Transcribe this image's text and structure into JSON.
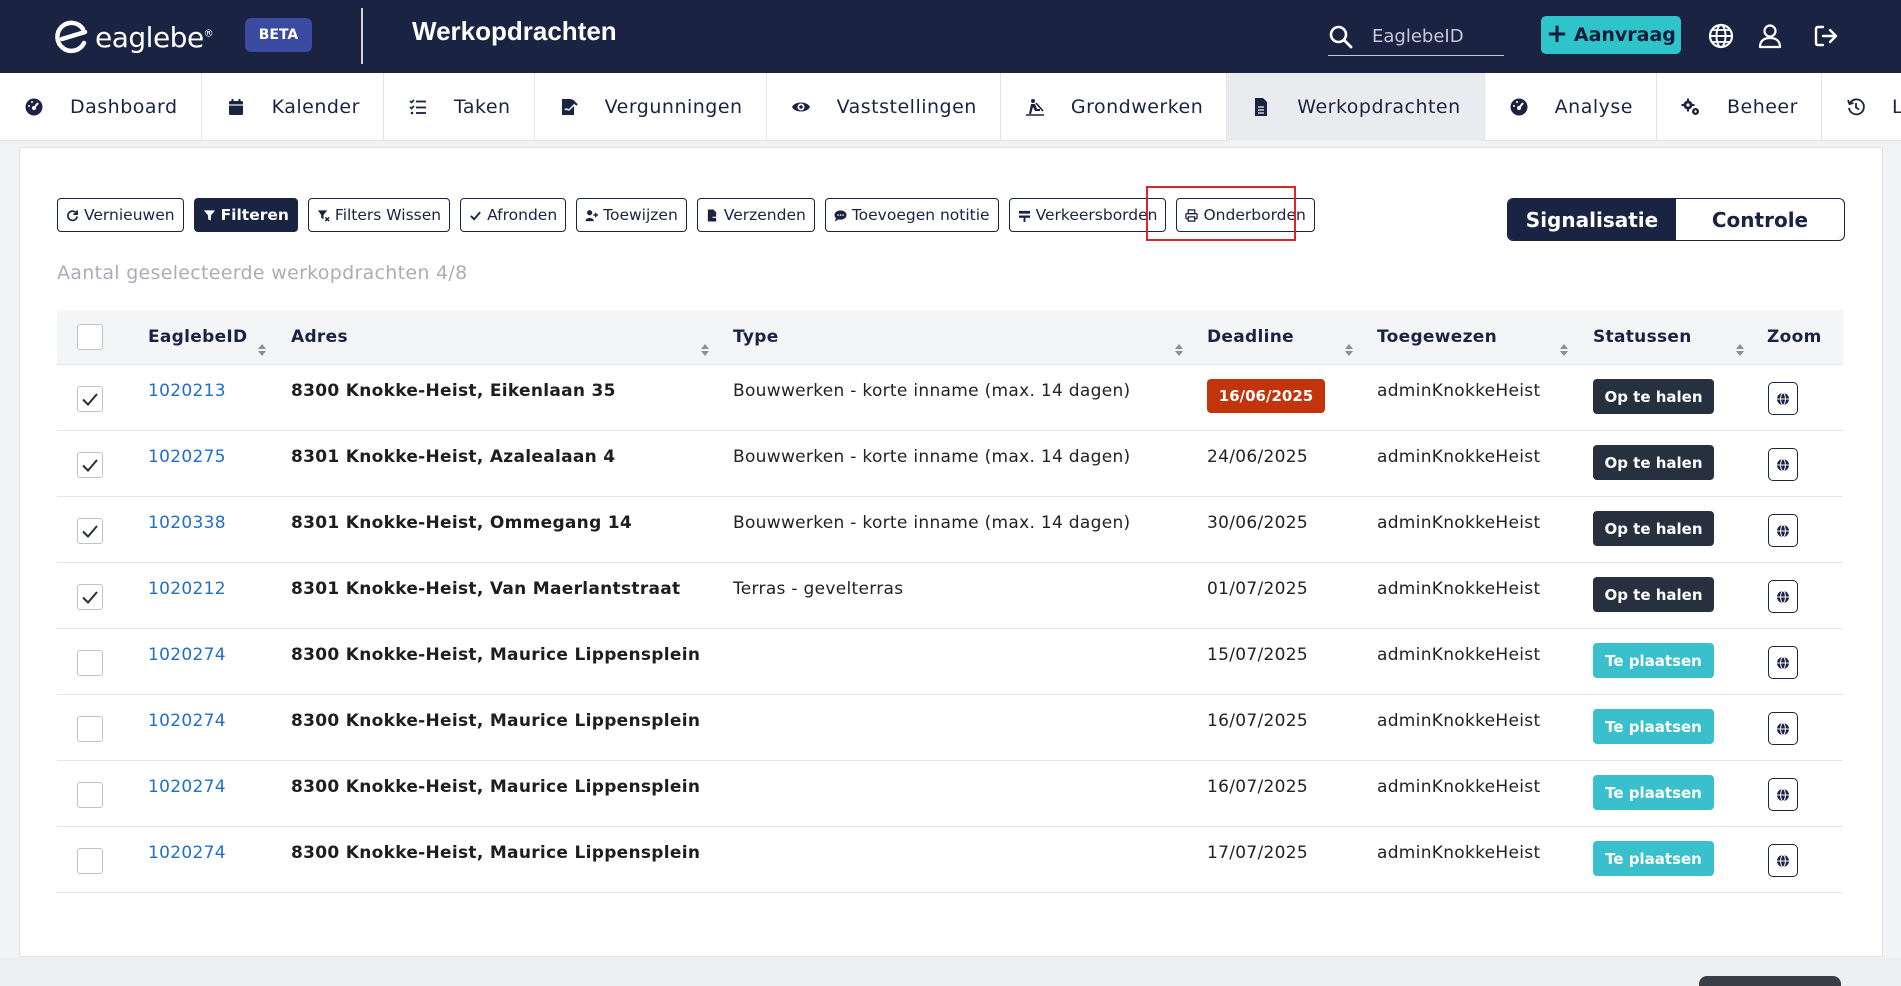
{
  "header": {
    "logo_text": "eaglebe",
    "logo_sup": "®",
    "beta_label": "BETA",
    "page_title": "Werkopdrachten",
    "search": {
      "placeholder": "EaglebeID",
      "value": ""
    },
    "aanvraag_label": "Aanvraag",
    "brand_color": "#1a2442",
    "accent_color": "#2ec4c9"
  },
  "nav": {
    "items": [
      {
        "label": "Dashboard",
        "icon": "gauge-icon"
      },
      {
        "label": "Kalender",
        "icon": "calendar-icon"
      },
      {
        "label": "Taken",
        "icon": "task-list-icon"
      },
      {
        "label": "Vergunningen",
        "icon": "signature-icon"
      },
      {
        "label": "Vaststellingen",
        "icon": "eye-icon"
      },
      {
        "label": "Grondwerken",
        "icon": "digging-icon"
      },
      {
        "label": "Werkopdrachten",
        "icon": "document-icon",
        "active": true
      },
      {
        "label": "Analyse",
        "icon": "gauge-icon"
      },
      {
        "label": "Beheer",
        "icon": "gears-icon"
      },
      {
        "label": "Logs",
        "icon": "history-icon"
      }
    ]
  },
  "toolbar": {
    "buttons": [
      {
        "label": "Vernieuwen",
        "icon": "refresh-icon"
      },
      {
        "label": "Filteren",
        "icon": "filter-icon",
        "active": true
      },
      {
        "label": "Filters Wissen",
        "icon": "filter-clear-icon"
      },
      {
        "label": "Afronden",
        "icon": "check-icon"
      },
      {
        "label": "Toewijzen",
        "icon": "user-plus-icon"
      },
      {
        "label": "Verzenden",
        "icon": "file-send-icon"
      },
      {
        "label": "Toevoegen notitie",
        "icon": "comment-icon"
      },
      {
        "label": "Verkeersborden",
        "icon": "sign-icon"
      },
      {
        "label": "Onderborden",
        "icon": "print-icon"
      }
    ]
  },
  "segment": {
    "options": [
      "Signalisatie",
      "Controle"
    ],
    "selected": "Signalisatie"
  },
  "selection_text": "Aantal geselecteerde werkopdrachten 4/8",
  "table": {
    "columns": [
      "EaglebeID",
      "Adres",
      "Type",
      "Deadline",
      "Toegewezen",
      "Statussen",
      "Zoom"
    ],
    "rows": [
      {
        "checked": true,
        "id": "1020213",
        "adres": "8300 Knokke-Heist, Eikenlaan 35",
        "type": "Bouwwerken - korte inname (max. 14 dagen)",
        "deadline": "16/06/2025",
        "overdue": true,
        "toegewezen": "adminKnokkeHeist",
        "status": "Op te halen",
        "status_kind": "dark"
      },
      {
        "checked": true,
        "id": "1020275",
        "adres": "8301 Knokke-Heist, Azalealaan 4",
        "type": "Bouwwerken - korte inname (max. 14 dagen)",
        "deadline": "24/06/2025",
        "overdue": false,
        "toegewezen": "adminKnokkeHeist",
        "status": "Op te halen",
        "status_kind": "dark"
      },
      {
        "checked": true,
        "id": "1020338",
        "adres": "8301 Knokke-Heist, Ommegang 14",
        "type": "Bouwwerken - korte inname (max. 14 dagen)",
        "deadline": "30/06/2025",
        "overdue": false,
        "toegewezen": "adminKnokkeHeist",
        "status": "Op te halen",
        "status_kind": "dark"
      },
      {
        "checked": true,
        "id": "1020212",
        "adres": "8301 Knokke-Heist, Van Maerlantstraat",
        "type": "Terras - gevelterras",
        "deadline": "01/07/2025",
        "overdue": false,
        "toegewezen": "adminKnokkeHeist",
        "status": "Op te halen",
        "status_kind": "dark"
      },
      {
        "checked": false,
        "id": "1020274",
        "adres": "8300 Knokke-Heist, Maurice Lippensplein",
        "type": "",
        "deadline": "15/07/2025",
        "overdue": false,
        "toegewezen": "adminKnokkeHeist",
        "status": "Te plaatsen",
        "status_kind": "teal"
      },
      {
        "checked": false,
        "id": "1020274",
        "adres": "8300 Knokke-Heist, Maurice Lippensplein",
        "type": "",
        "deadline": "16/07/2025",
        "overdue": false,
        "toegewezen": "adminKnokkeHeist",
        "status": "Te plaatsen",
        "status_kind": "teal"
      },
      {
        "checked": false,
        "id": "1020274",
        "adres": "8300 Knokke-Heist, Maurice Lippensplein",
        "type": "",
        "deadline": "16/07/2025",
        "overdue": false,
        "toegewezen": "adminKnokkeHeist",
        "status": "Te plaatsen",
        "status_kind": "teal"
      },
      {
        "checked": false,
        "id": "1020274",
        "adres": "8300 Knokke-Heist, Maurice Lippensplein",
        "type": "",
        "deadline": "17/07/2025",
        "overdue": false,
        "toegewezen": "adminKnokkeHeist",
        "status": "Te plaatsen",
        "status_kind": "teal"
      }
    ]
  }
}
